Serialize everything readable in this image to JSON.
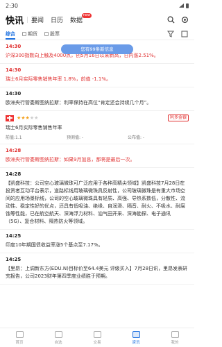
{
  "status": {
    "time": "2:30"
  },
  "nav": {
    "active": "快讯",
    "items": [
      "要闻",
      "日历",
      "数据"
    ],
    "badge": "new"
  },
  "subnav": {
    "items": [
      "综合",
      "期货",
      "股票"
    ]
  },
  "pill": "您有99条新信息",
  "feed": [
    {
      "time": "14:30",
      "text": "沪深300指数向上触及4000点，创5月16日以来新高，日内涨2.51%。",
      "red": true
    },
    {
      "time": "14:30",
      "text": "瑞士6月实际零售销售年率 1.8%，前值 -1.1%。",
      "red": true
    },
    {
      "time": "14:30",
      "text": "欧洲央行管委斯图纳拉斯：利率保持在高位“肯定还会持续几个月”。",
      "red": false
    },
    {
      "type": "data",
      "stars": 3,
      "tag": "利多金银",
      "title": "瑞士6月实际零售销售年率",
      "prev_label": "前值:1.1",
      "forecast_label": "预测值: -",
      "actual_label": "公布值: -"
    },
    {
      "time": "14:28",
      "text": "欧洲央行管委斯图纳拉斯：如果9月加息，那将是最后一次。",
      "red": true
    },
    {
      "time": "14:28",
      "text": "【凯盛科技：公司空心玻璃微珠可广泛应用于各种高精尖领域】凯盛科技7月28日在投资者互动平台表示，道路标线用玻璃微珠具反射性，公司玻璃微珠是有重大市场空间的应用场景标线，公司的空心玻璃微珠具有轻质、高强、导热系数低，分散性、流动性、稳定性好的优点，还具有低吸油、绝缘、自润滑、隔音、耐火、不吸水、耐腐蚀等性能，已在航空航天、深海浮力材料、油气田开采、深海勘探、电子通讯（5G）、复合材料、隔热防火等领域。",
      "red": false
    },
    {
      "time": "14:25",
      "text": "印度10年期国债收益率涨5个基点至7.17%。",
      "red": false
    },
    {
      "time": "14:25",
      "text": "【里昂：上调新东方(EDU.N)目标价至64.4美元 评级买入】7月28日讯，里昂发表研究报告，公司2023财年第四季度业绩胜于预期。",
      "red": false
    }
  ],
  "tabs": [
    "首页",
    "自选",
    "交易",
    "资讯",
    "我的"
  ],
  "active_tab": 3
}
